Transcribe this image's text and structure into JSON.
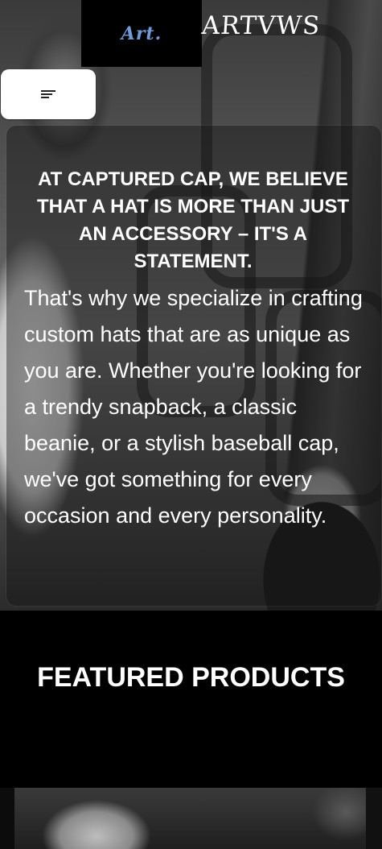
{
  "header": {
    "logo_mark": "Art.",
    "brand_name": "ARTVWS"
  },
  "menu": {
    "icon": "hamburger-menu-icon"
  },
  "intro": {
    "heading": "AT CAPTURED CAP, WE BELIEVE THAT A HAT IS MORE THAN JUST AN ACCESSORY – IT'S A STATEMENT.",
    "body": "That's why we specialize in crafting custom hats that are as unique as you are. Whether you're looking for a trendy snapback, a classic beanie, or a stylish baseball cap, we've got something for every occasion and every personality."
  },
  "featured": {
    "title": "FEATURED PRODUCTS"
  },
  "colors": {
    "logo_accent": "#6f9bd8",
    "page_background": "#000000",
    "menu_button": "#ffffff"
  }
}
